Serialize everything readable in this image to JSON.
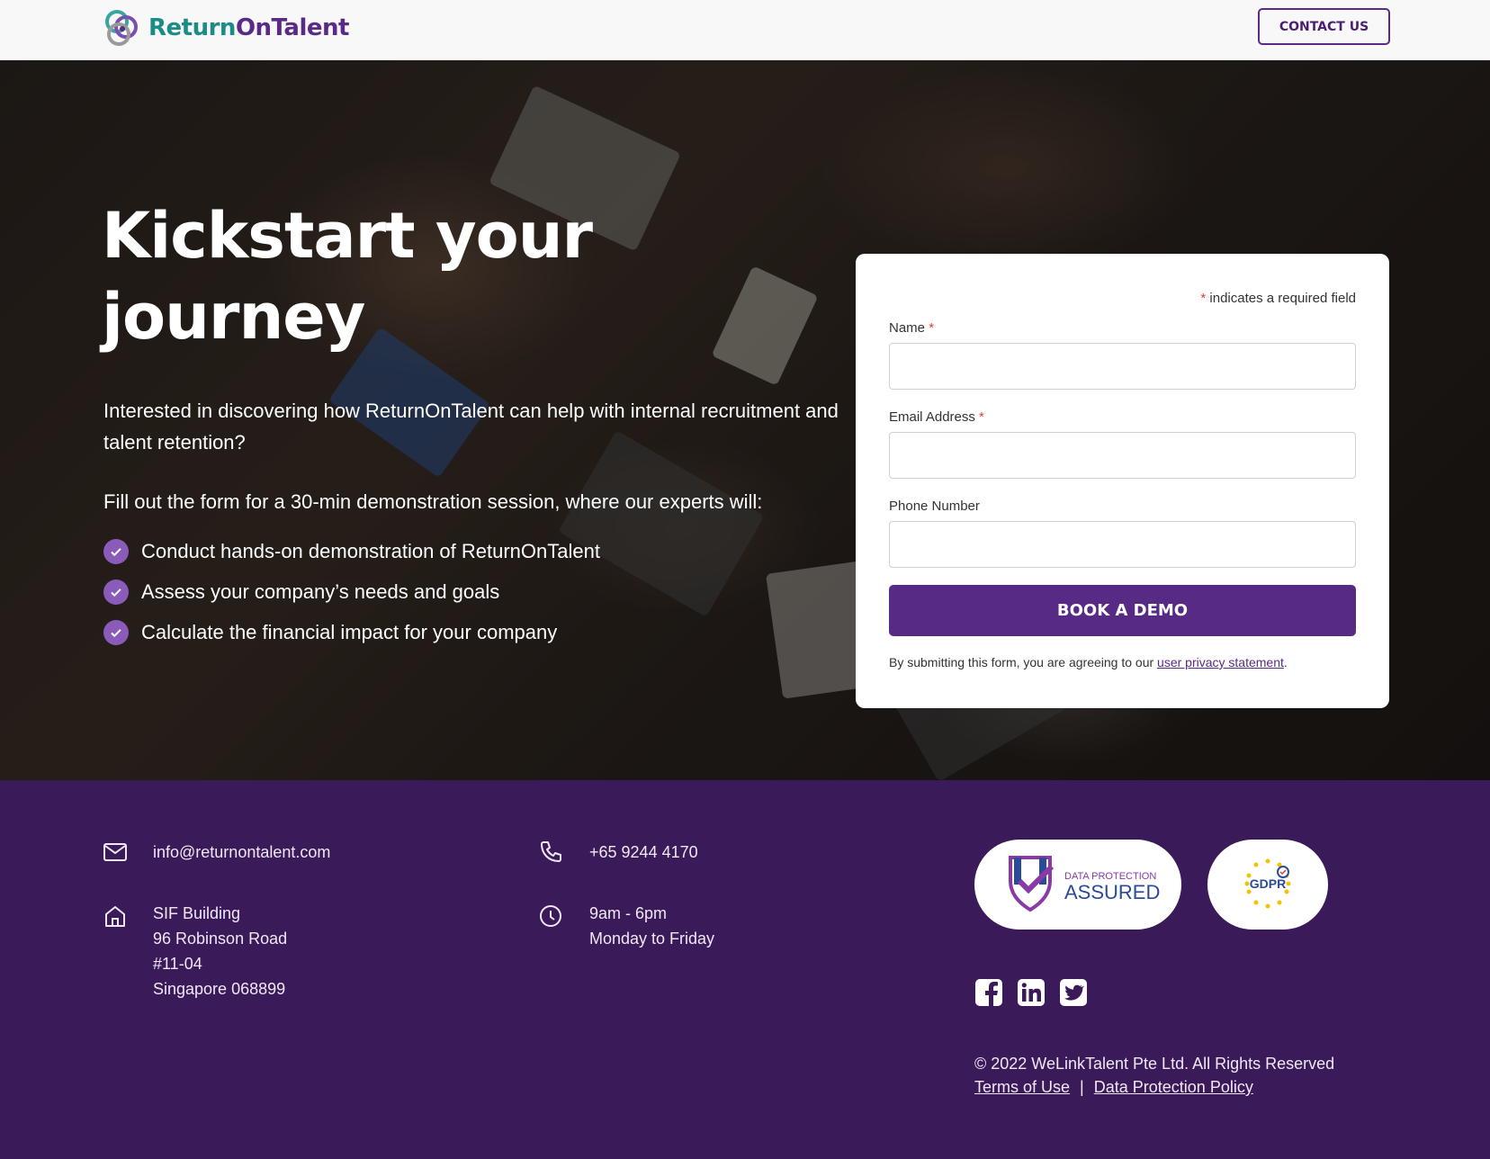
{
  "header": {
    "brand_part1": "Return",
    "brand_part2": "OnTalent",
    "contact_label": "CONTACT US"
  },
  "hero": {
    "title": "Kickstart your journey",
    "intro": "Interested in discovering how ReturnOnTalent can help with internal recruitment and talent retention?",
    "lead": "Fill out the form for a 30-min demonstration session, where our experts will:",
    "bullets": [
      "Conduct hands-on demonstration of ReturnOnTalent",
      "Assess your company’s needs and goals",
      "Calculate the financial impact for your company"
    ]
  },
  "form": {
    "required_mark": "*",
    "required_note": "indicates a required field",
    "name_label": "Name",
    "name_value": "",
    "email_label": "Email Address",
    "email_value": "",
    "phone_label": "Phone Number",
    "phone_value": "",
    "submit_label": "BOOK A DEMO",
    "consent_text": "By submitting this form, you are agreeing to our",
    "consent_link": "user privacy statement",
    "consent_end": "."
  },
  "footer": {
    "email": "info@returnontalent.com",
    "phone": "+65 9244 4170",
    "address": [
      "SIF Building",
      "96 Robinson Road",
      "#11-04",
      "Singapore 068899"
    ],
    "hours": [
      "9am - 6pm",
      "Monday to Friday"
    ],
    "badge1_small": "DATA PROTECTION",
    "badge1_large": "ASSURED",
    "badge2_label": "GDPR",
    "copyright": "© 2022 WeLinkTalent Pte Ltd. All Rights Reserved",
    "terms_link": "Terms of Use",
    "separator": "|",
    "dp_link": "Data Protection Policy"
  },
  "colors": {
    "brand_teal": "#1c8c86",
    "brand_purple": "#572a86",
    "footer_bg": "#3a1a59",
    "required": "#e23a3a"
  },
  "icons": [
    "logo-mark",
    "check-icon",
    "mail-icon",
    "phone-icon",
    "home-icon",
    "clock-icon",
    "facebook-icon",
    "linkedin-icon",
    "twitter-icon"
  ]
}
